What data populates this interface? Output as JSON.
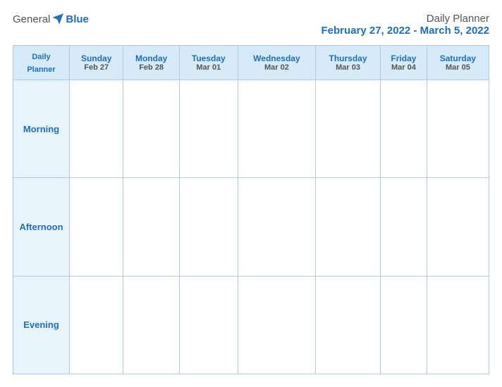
{
  "logo": {
    "general": "General",
    "blue": "Blue"
  },
  "title": {
    "main": "Daily Planner",
    "date_range": "February 27, 2022 - March 5, 2022"
  },
  "table": {
    "header_label_line1": "Daily",
    "header_label_line2": "Planner",
    "columns": [
      {
        "day": "Sunday",
        "date": "Feb 27"
      },
      {
        "day": "Monday",
        "date": "Feb 28"
      },
      {
        "day": "Tuesday",
        "date": "Mar 01"
      },
      {
        "day": "Wednesday",
        "date": "Mar 02"
      },
      {
        "day": "Thursday",
        "date": "Mar 03"
      },
      {
        "day": "Friday",
        "date": "Mar 04"
      },
      {
        "day": "Saturday",
        "date": "Mar 05"
      }
    ],
    "rows": [
      {
        "label": "Morning"
      },
      {
        "label": "Afternoon"
      },
      {
        "label": "Evening"
      }
    ]
  }
}
